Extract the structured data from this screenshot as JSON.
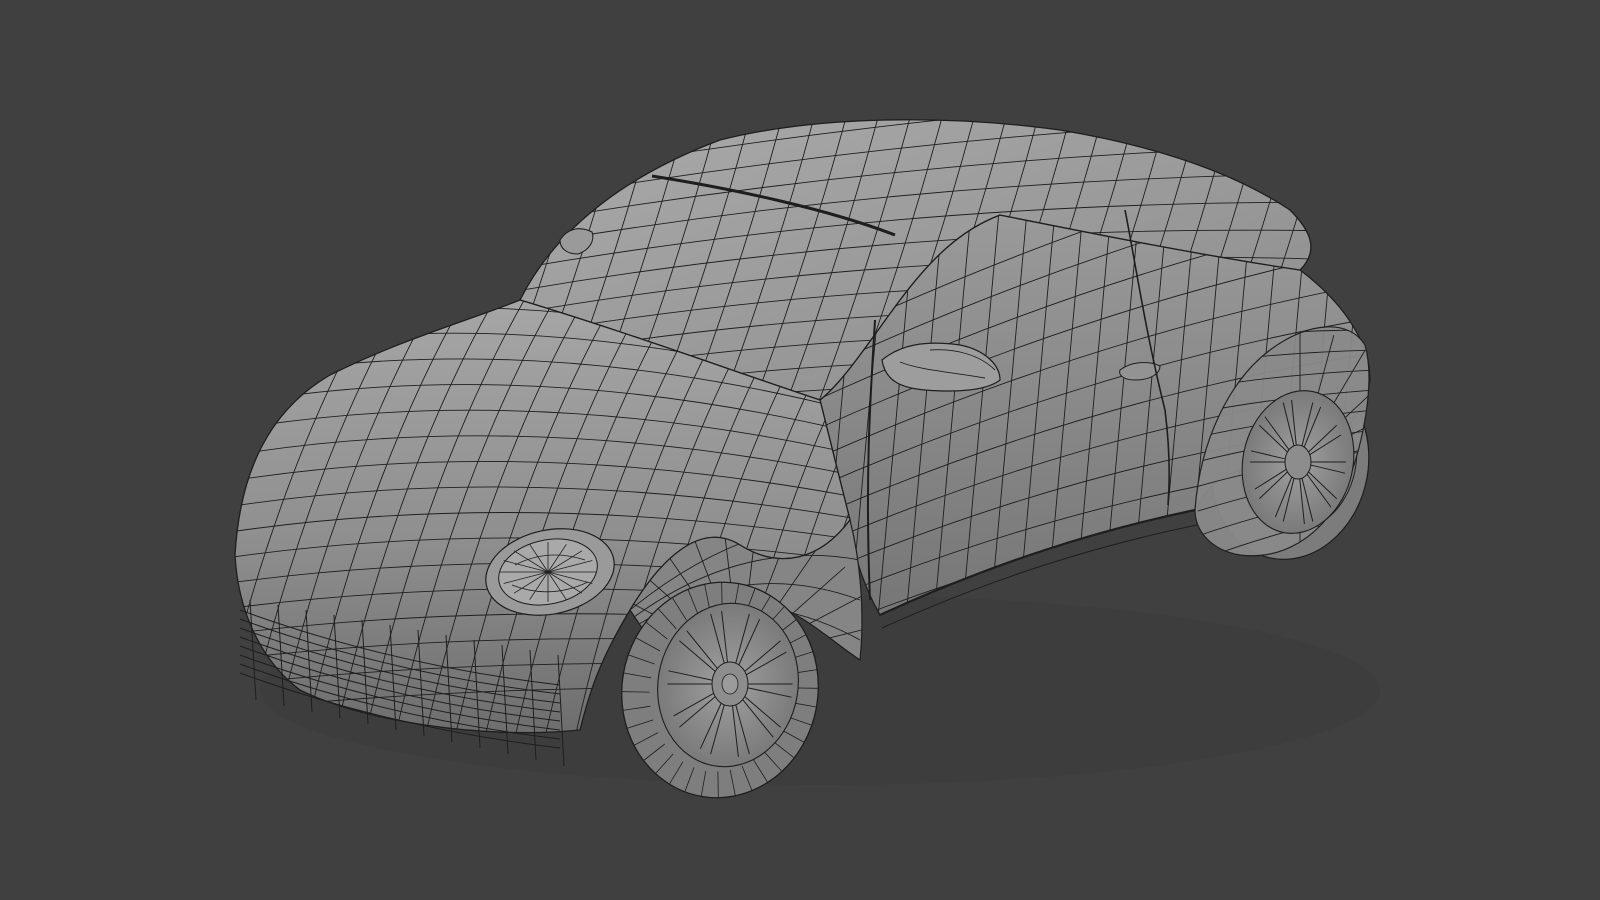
{
  "viewport": {
    "background": "#404040",
    "subject": "car-wireframe-mesh"
  },
  "colors": {
    "mesh_fill": "#8e8e8e",
    "mesh_fill_light": "#a4a4a4",
    "mesh_fill_dark": "#6a6a6a",
    "wire": "#1e1e1e",
    "tire": "#777777",
    "rim": "#9a9a9a",
    "shadow": "#383838"
  }
}
